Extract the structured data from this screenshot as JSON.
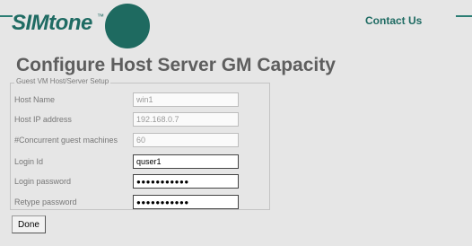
{
  "header": {
    "logo_text": "SIMtone",
    "logo_tm": "™",
    "contact_link": "Contact Us"
  },
  "page": {
    "title": "Configure Host Server GM Capacity"
  },
  "form": {
    "legend": "Guest VM Host/Server Setup",
    "fields": [
      {
        "label": "Host Name",
        "value": "win1"
      },
      {
        "label": "Host IP address",
        "value": "192.168.0.7"
      },
      {
        "label": "#Concurrent guest machines",
        "value": "60"
      },
      {
        "label": "Login Id",
        "value": "quser1"
      },
      {
        "label": "Login password",
        "value": "●●●●●●●●●●●"
      },
      {
        "label": "Retype password",
        "value": "●●●●●●●●●●●"
      }
    ],
    "done_label": "Done"
  },
  "colors": {
    "brand": "#1f6b63",
    "background": "#e6e6e6"
  }
}
